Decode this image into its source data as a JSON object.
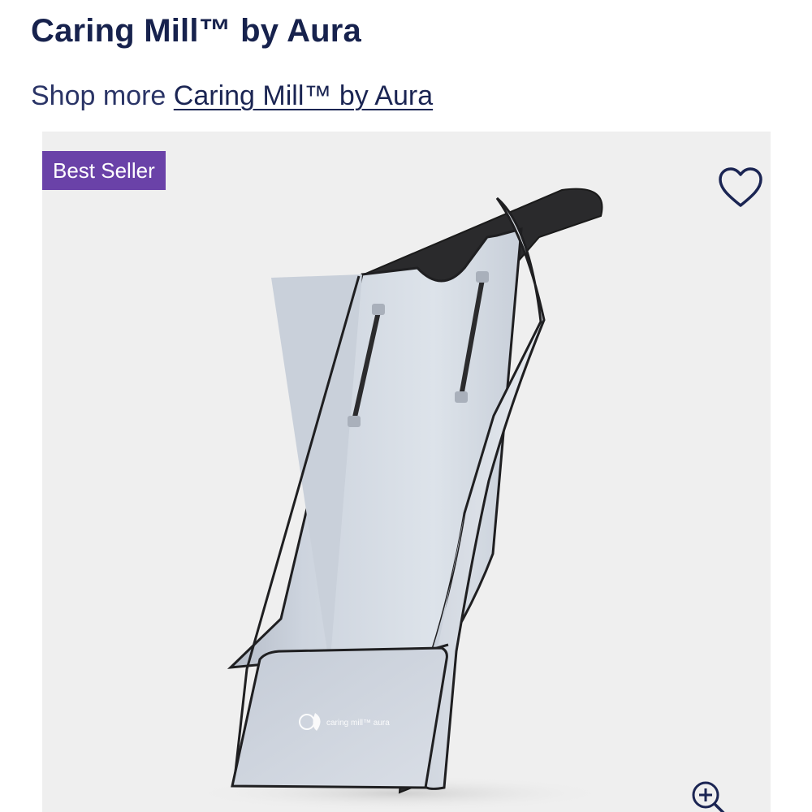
{
  "product": {
    "title_line": "Caring Mill™ by Aura"
  },
  "shop_more": {
    "prefix": "Shop more",
    "brand_link": "Caring Mill™ by Aura"
  },
  "gallery": {
    "badge": "Best Seller",
    "wishlist_icon": "heart-outline-icon",
    "zoom_icon": "zoom-in-icon",
    "product_logo_text": "caring mill™ aura"
  },
  "colors": {
    "title": "#17224d",
    "badge_bg": "#6a42a8",
    "gallery_bg": "#efefef"
  }
}
